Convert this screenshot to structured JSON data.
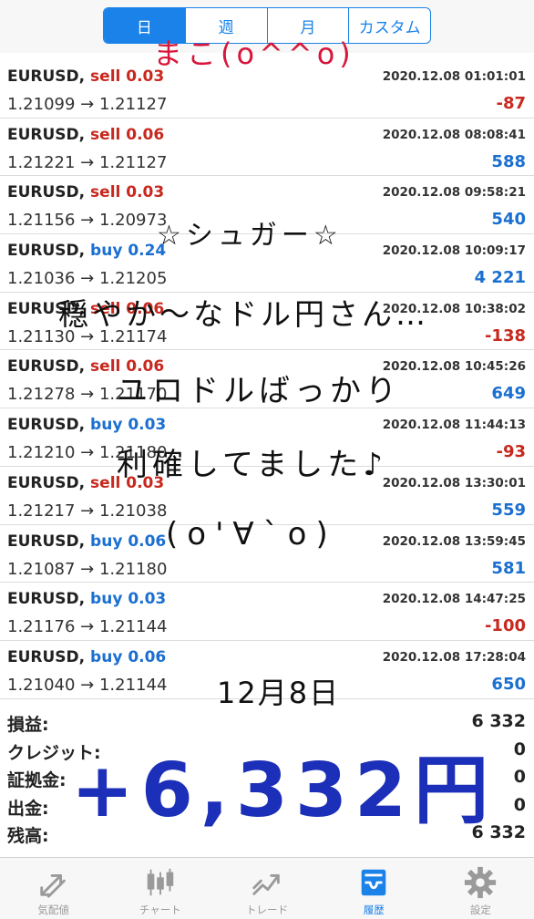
{
  "period_tabs": [
    "日",
    "週",
    "月",
    "カスタム"
  ],
  "active_tab_index": 0,
  "accent_color": "#1a82e8",
  "sell_color": "#c8281e",
  "buy_color": "#1a6fd0",
  "trades": [
    {
      "symbol": "EURUSD,",
      "side": "sell",
      "volume": "sell 0.03",
      "time": "2020.12.08 01:01:01",
      "prices": "1.21099 → 1.21127",
      "profit": "-87"
    },
    {
      "symbol": "EURUSD,",
      "side": "sell",
      "volume": "sell 0.06",
      "time": "2020.12.08 08:08:41",
      "prices": "1.21221 → 1.21127",
      "profit": "588"
    },
    {
      "symbol": "EURUSD,",
      "side": "sell",
      "volume": "sell 0.03",
      "time": "2020.12.08 09:58:21",
      "prices": "1.21156 → 1.20973",
      "profit": "540"
    },
    {
      "symbol": "EURUSD,",
      "side": "buy",
      "volume": "buy 0.24",
      "time": "2020.12.08 10:09:17",
      "prices": "1.21036 → 1.21205",
      "profit": "4 221"
    },
    {
      "symbol": "EURUSD,",
      "side": "sell",
      "volume": "sell 0.06",
      "time": "2020.12.08 10:38:02",
      "prices": "1.21130 → 1.21174",
      "profit": "-138"
    },
    {
      "symbol": "EURUSD,",
      "side": "sell",
      "volume": "sell 0.06",
      "time": "2020.12.08 10:45:26",
      "prices": "1.21278 → 1.21170",
      "profit": "649"
    },
    {
      "symbol": "EURUSD,",
      "side": "buy",
      "volume": "buy 0.03",
      "time": "2020.12.08 11:44:13",
      "prices": "1.21210 → 1.21180",
      "profit": "-93"
    },
    {
      "symbol": "EURUSD,",
      "side": "sell",
      "volume": "sell 0.03",
      "time": "2020.12.08 13:30:01",
      "prices": "1.21217 → 1.21038",
      "profit": "559"
    },
    {
      "symbol": "EURUSD,",
      "side": "buy",
      "volume": "buy 0.06",
      "time": "2020.12.08 13:59:45",
      "prices": "1.21087 → 1.21180",
      "profit": "581"
    },
    {
      "symbol": "EURUSD,",
      "side": "buy",
      "volume": "buy 0.03",
      "time": "2020.12.08 14:47:25",
      "prices": "1.21176 → 1.21144",
      "profit": "-100"
    },
    {
      "symbol": "EURUSD,",
      "side": "buy",
      "volume": "buy 0.06",
      "time": "2020.12.08 17:28:04",
      "prices": "1.21040 → 1.21144",
      "profit": "650"
    }
  ],
  "summary": [
    {
      "label": "損益:",
      "value": "6 332"
    },
    {
      "label": "クレジット:",
      "value": "0"
    },
    {
      "label": "証拠金:",
      "value": "0"
    },
    {
      "label": "出金:",
      "value": "0"
    },
    {
      "label": "残高:",
      "value": "6 332"
    }
  ],
  "bottom_tabs": [
    {
      "label": "気配値",
      "icon": "quotes-arrows-icon"
    },
    {
      "label": "チャート",
      "icon": "candlestick-chart-icon"
    },
    {
      "label": "トレード",
      "icon": "trade-trend-icon"
    },
    {
      "label": "履歴",
      "icon": "history-inbox-icon"
    },
    {
      "label": "設定",
      "icon": "settings-gear-icon"
    }
  ],
  "active_bottom_tab_index": 3,
  "handwriting": {
    "mako": "まこ(o^^o)",
    "sugar": "☆シュガー☆",
    "line1": "穏やか〜なドル円さん…",
    "line2": "ユロドルばっかり",
    "line3": "利確してました♪",
    "face": "(o'∀`o)",
    "date": "12月8日",
    "total": "+6,332円"
  }
}
